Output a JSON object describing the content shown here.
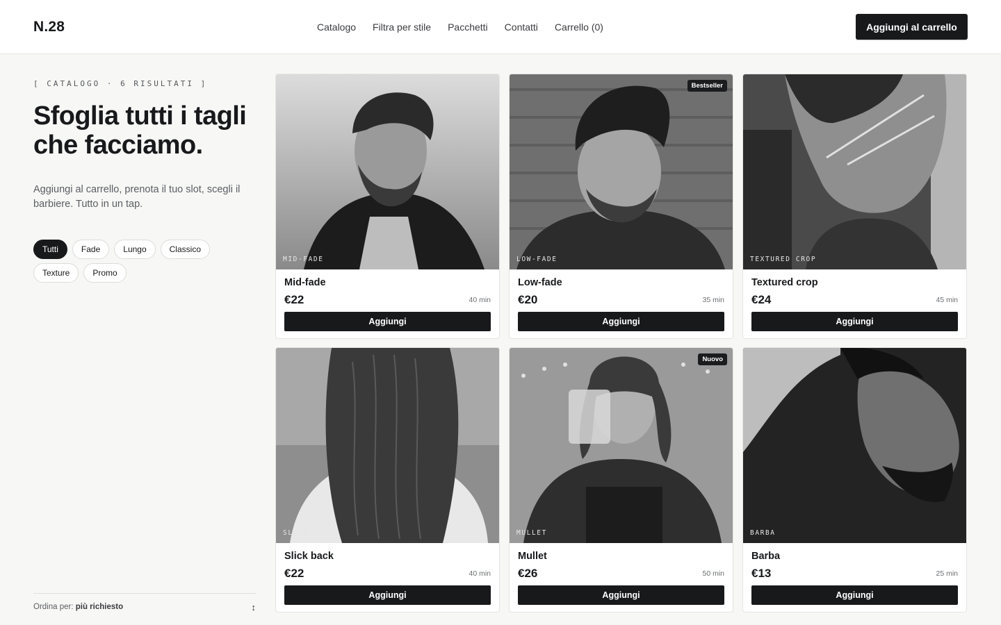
{
  "brand": {
    "logo": "N.28"
  },
  "nav": {
    "items": [
      "Catalogo",
      "Filtra per stile",
      "Pacchetti",
      "Contatti",
      "Carrello (0)"
    ],
    "cta": "Aggiungi al carrello"
  },
  "sidebar": {
    "eyebrow": "[ CATALOGO · 6 RISULTATI ]",
    "headline": "Sfoglia tutti i tagli che facciamo.",
    "lede": "Aggiungi al carrello, prenota il tuo slot, scegli il barbiere. Tutto in un tap.",
    "filters": [
      "Tutti",
      "Fade",
      "Lungo",
      "Classico",
      "Texture",
      "Promo"
    ],
    "active_filter": "Tutti",
    "sort_label": "Ordina per:",
    "sort_value": "più richiesto",
    "sort_icon": "↕"
  },
  "products": [
    {
      "image_label": "MID-FADE",
      "name": "Mid-fade",
      "price": "€22",
      "duration": "40 min",
      "badge": "",
      "button": "Aggiungi"
    },
    {
      "image_label": "LOW-FADE",
      "name": "Low-fade",
      "price": "€20",
      "duration": "35 min",
      "badge": "Bestseller",
      "button": "Aggiungi"
    },
    {
      "image_label": "TEXTURED CROP",
      "name": "Textured crop",
      "price": "€24",
      "duration": "45 min",
      "badge": "",
      "button": "Aggiungi"
    },
    {
      "image_label": "SLICK BACK",
      "name": "Slick back",
      "price": "€22",
      "duration": "40 min",
      "badge": "",
      "button": "Aggiungi"
    },
    {
      "image_label": "MULLET",
      "name": "Mullet",
      "price": "€26",
      "duration": "50 min",
      "badge": "Nuovo",
      "button": "Aggiungi"
    },
    {
      "image_label": "BARBA",
      "name": "Barba",
      "price": "€13",
      "duration": "25 min",
      "badge": "",
      "button": "Aggiungi"
    }
  ],
  "colors": {
    "primary": "#18191b",
    "background": "#f7f7f6",
    "card": "#ffffff",
    "muted": "#5b5d61"
  }
}
